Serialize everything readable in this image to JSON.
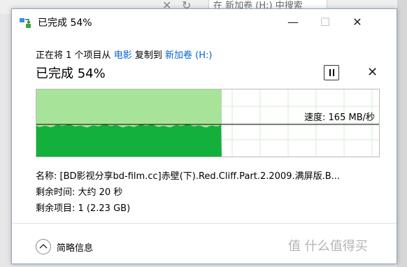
{
  "background": {
    "search_placeholder": "在 新加卷 (H:) 中搜索"
  },
  "dialog": {
    "title": "已完成 54%",
    "copy_prefix": "正在将 1 个项目从",
    "source": "电影",
    "copy_middle": "复制到",
    "destination": "新加卷 (H:)",
    "status": "已完成 54%",
    "progress": 0.54,
    "speed_label": "速度: 165 MB/秒",
    "name_label": "名称:",
    "name_value": "[BD影视分享bd-film.cc]赤壁(下).Red.Cliff.Part.2.2009.满屏版.B...",
    "time_label": "剩余时间:",
    "time_value": "大约 20 秒",
    "items_label": "剩余项目:",
    "items_value": "1 (2.23 GB)",
    "footer_label": "简略信息"
  },
  "colors": {
    "graph_fill_light": "#a8e39a",
    "graph_fill_dark": "#13b03b",
    "link": "#0066cc",
    "grid": "#d6edd2"
  },
  "icons": {
    "title_icon": "copy-arrows-icon",
    "pause": "pause-icon",
    "cancel": "close-icon",
    "collapse": "chevron-up-icon"
  },
  "watermark": {
    "text": "值 什么值得买"
  }
}
